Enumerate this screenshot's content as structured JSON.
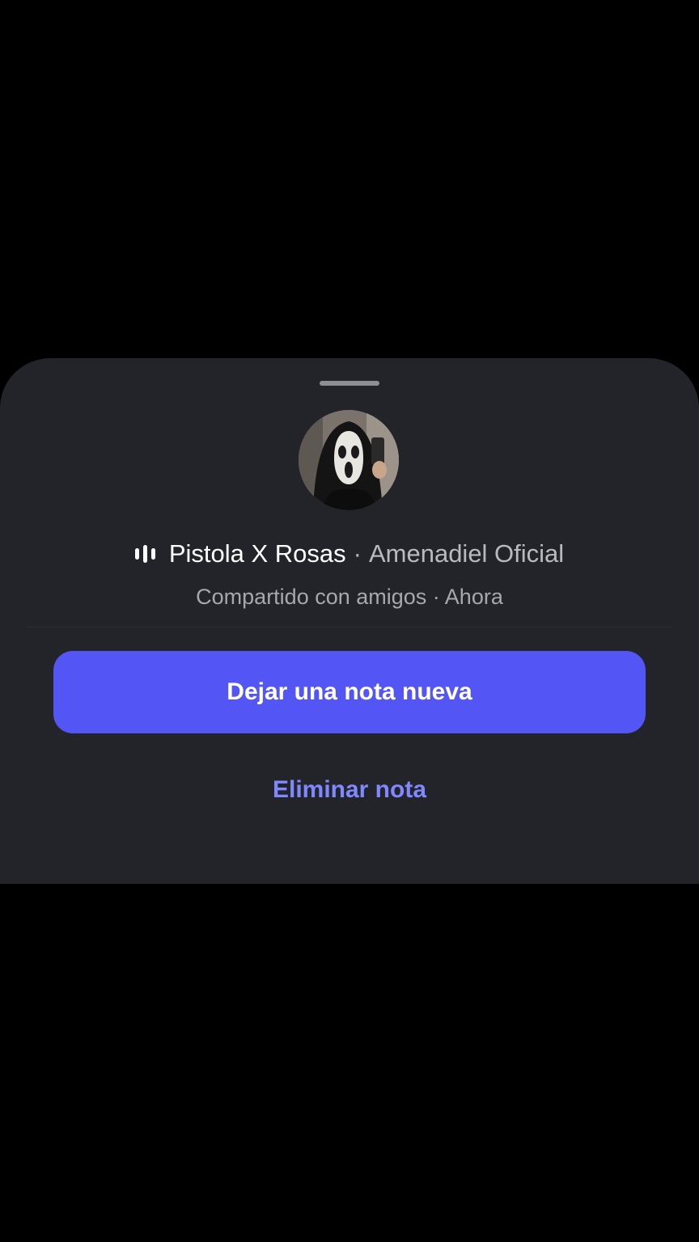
{
  "note_sheet": {
    "song_title": "Pistola X Rosas",
    "separator": "·",
    "artist": "Amenadiel Oficial",
    "shared_with": "Compartido con amigos · Ahora",
    "primary_action_label": "Dejar una nota nueva",
    "delete_action_label": "Eliminar nota",
    "icons": {
      "music": "music-bars-icon",
      "avatar": "profile-avatar"
    }
  },
  "colors": {
    "background": "#000000",
    "sheet": "#232429",
    "accent_button": "#5356f4",
    "link": "#7f88ff",
    "muted_text": "#a7a8ad"
  }
}
